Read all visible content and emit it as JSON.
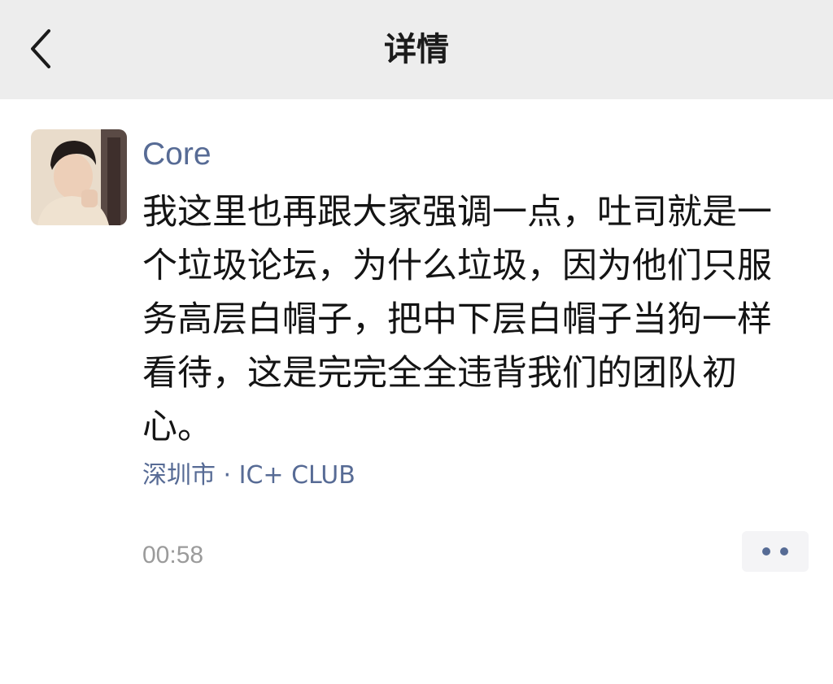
{
  "nav": {
    "title": "详情",
    "back_icon": "chevron-left-icon"
  },
  "post": {
    "author": "Core",
    "avatar_icon": "user-avatar",
    "content": "我这里也再跟大家强调一点，吐司就是一个垃圾论坛，为什么垃圾，因为他们只服务高层白帽子，把中下层白帽子当狗一样看待，这是完完全全违背我们的团队初心。",
    "location": "深圳市 · IC+ CLUB",
    "time": "00:58",
    "more_icon": "more-dots-icon"
  },
  "colors": {
    "nav_background": "#ededed",
    "link_blue": "#576b95",
    "text": "#141414",
    "time_gray": "#9b9b9b"
  }
}
